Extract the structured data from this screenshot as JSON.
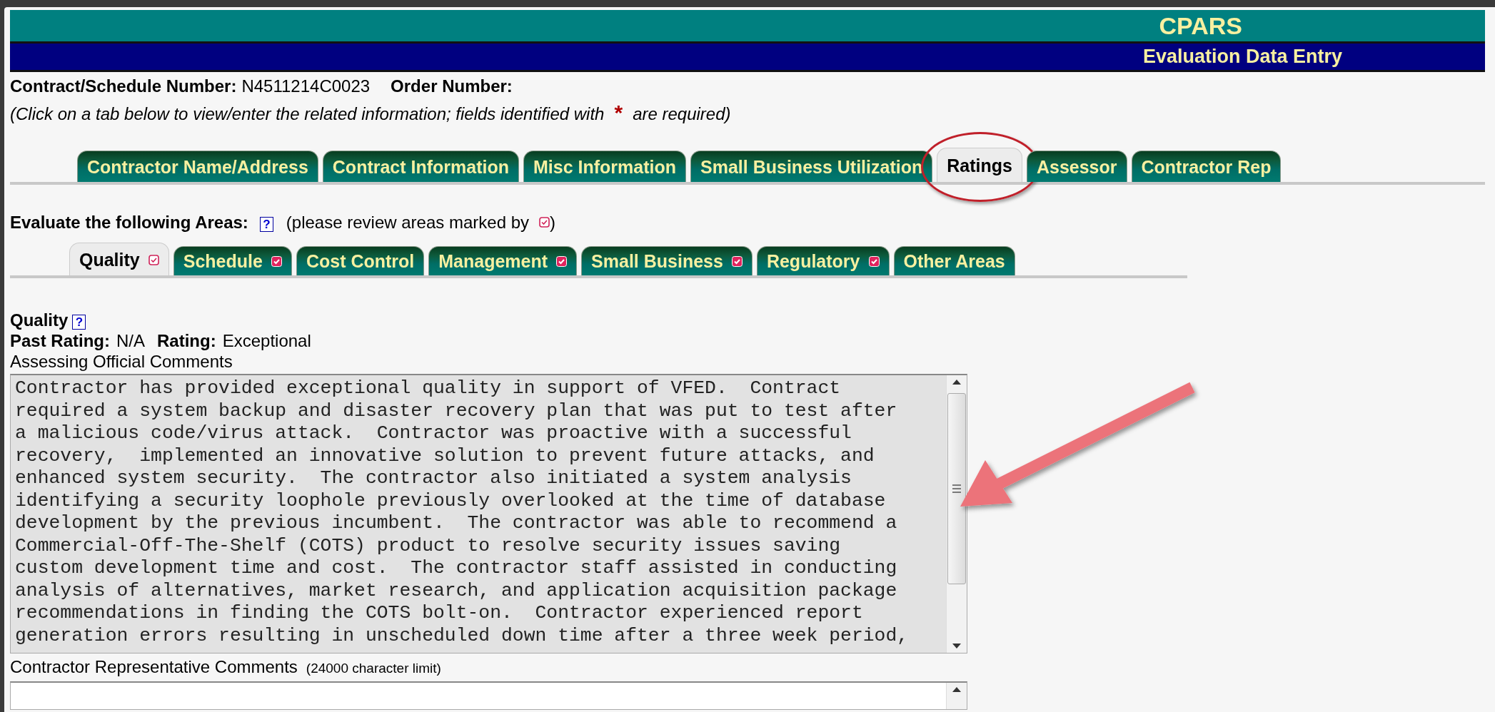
{
  "header": {
    "title": "CPARS",
    "subtitle": "Evaluation Data Entry"
  },
  "contract": {
    "number_label": "Contract/Schedule Number:",
    "number": "N4511214C0023",
    "order_label": "Order Number:"
  },
  "hint": {
    "before": "(Click on a tab below to view/enter the related information; fields identified with",
    "star": "*",
    "after": "are required)"
  },
  "tabs": [
    {
      "label": "Contractor Name/Address",
      "selected": false,
      "circled": false
    },
    {
      "label": "Contract Information",
      "selected": false,
      "circled": false
    },
    {
      "label": "Misc Information",
      "selected": false,
      "circled": false
    },
    {
      "label": "Small Business Utilization",
      "selected": false,
      "circled": false
    },
    {
      "label": "Ratings",
      "selected": true,
      "circled": true
    },
    {
      "label": "Assessor",
      "selected": false,
      "circled": false
    },
    {
      "label": "Contractor Rep",
      "selected": false,
      "circled": false
    }
  ],
  "evaluate": {
    "label": "Evaluate the following Areas:",
    "help": "?",
    "note_before": "(please review areas marked by",
    "note_after": ")"
  },
  "area_tabs": [
    {
      "label": "Quality",
      "selected": true,
      "marked": true
    },
    {
      "label": "Schedule",
      "selected": false,
      "marked": true
    },
    {
      "label": "Cost Control",
      "selected": false,
      "marked": false
    },
    {
      "label": "Management",
      "selected": false,
      "marked": true
    },
    {
      "label": "Small Business",
      "selected": false,
      "marked": true
    },
    {
      "label": "Regulatory",
      "selected": false,
      "marked": true
    },
    {
      "label": "Other Areas",
      "selected": false,
      "marked": false
    }
  ],
  "quality": {
    "title": "Quality",
    "help": "?",
    "past_rating_label": "Past Rating:",
    "past_rating": "N/A",
    "rating_label": "Rating:",
    "rating": "Exceptional",
    "comments_label": "Assessing Official Comments",
    "comments": [
      "Contractor has provided exceptional quality in support of VFED.  Contract",
      "required a system backup and disaster recovery plan that was put to test after",
      "a malicious code/virus attack.  Contractor was proactive with a successful",
      "recovery,  implemented an innovative solution to prevent future attacks, and",
      "enhanced system security.  The contractor also initiated a system analysis",
      "identifying a security loophole previously overlooked at the time of database",
      "development by the previous incumbent.  The contractor was able to recommend a",
      "Commercial-Off-The-Shelf (COTS) product to resolve security issues saving",
      "custom development time and cost.  The contractor staff assisted in conducting",
      "analysis of alternatives, market research, and application acquisition package",
      "recommendations in finding the COTS bolt-on.  Contractor experienced report",
      "generation errors resulting in unscheduled down time after a three week period,"
    ],
    "rep_label": "Contractor Representative Comments",
    "rep_limit": "(24000 character limit)"
  },
  "annotations": [
    {
      "kind": "arrow"
    }
  ]
}
